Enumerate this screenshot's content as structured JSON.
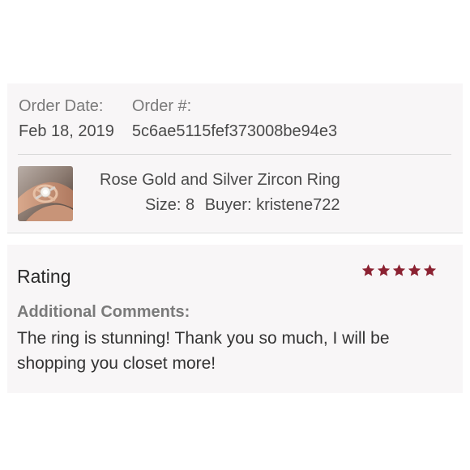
{
  "order": {
    "date_label": "Order Date:",
    "date_value": "Feb 18, 2019",
    "number_label": "Order #:",
    "number_value": "5c6ae5115fef373008be94e3"
  },
  "item": {
    "title": "Rose Gold and Silver Zircon Ring",
    "size_text": "Size: 8",
    "buyer_text": "Buyer: kristene722",
    "thumbnail_icon": "ring-photo"
  },
  "rating": {
    "label": "Rating",
    "stars": 5,
    "max_stars": 5,
    "star_color": "#8b2131",
    "comments_label": "Additional Comments:",
    "comments_text": "The ring is stunning! Thank you so much, I will be shopping you closet more!"
  }
}
